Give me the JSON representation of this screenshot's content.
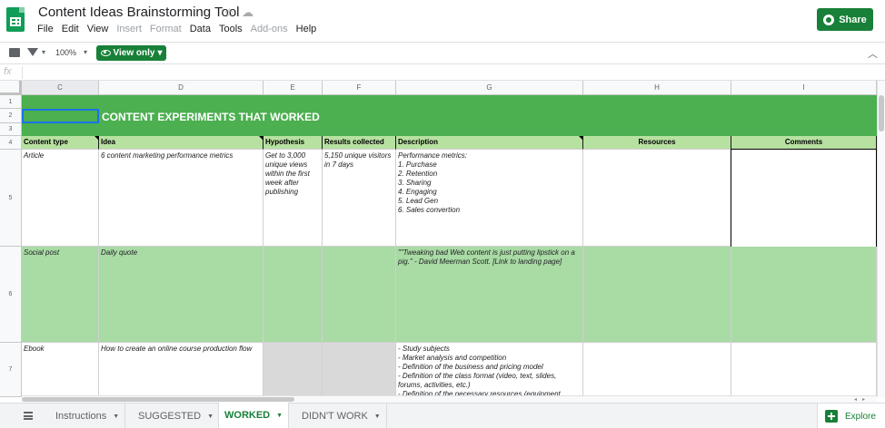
{
  "app": {
    "title": "Content Ideas Brainstorming Tool",
    "share_label": "Share",
    "menu": [
      "File",
      "Edit",
      "View",
      "Insert",
      "Format",
      "Data",
      "Tools",
      "Add-ons",
      "Help"
    ],
    "menu_disabled": [
      "Insert",
      "Format",
      "Add-ons"
    ]
  },
  "toolbar": {
    "zoom": "100%",
    "view_only_label": "View only",
    "fx": "fx"
  },
  "columns": [
    "C",
    "D",
    "E",
    "F",
    "G",
    "H",
    "I"
  ],
  "rows": [
    "1",
    "2",
    "3",
    "4",
    "5",
    "6",
    "7"
  ],
  "sheet": {
    "title": "CONTENT EXPERIMENTS THAT WORKED",
    "headers": {
      "content_type": "Content type",
      "idea": "Idea",
      "hypothesis": "Hypothesis",
      "results": "Results collected",
      "description": "Description",
      "resources": "Resources",
      "comments": "Comments"
    },
    "row5": {
      "content_type": "Article",
      "idea": "6 content marketing performance metrics",
      "hypothesis": "Get to 3,000 unique views within the first week after publishing",
      "results": "5,150 unique visitors in 7 days",
      "description": [
        "Performance metrics:",
        "1. Purchase",
        "2. Retention",
        "3. Sharing",
        "4. Engaging",
        "5. Lead Gen",
        "6. Sales convertion"
      ]
    },
    "row6": {
      "content_type": "Social post",
      "idea": "Daily quote",
      "description": "\"\"Tweaking bad Web content is just putting lipstick on a pig.\" - David Meerman Scott. [Link to landing page]"
    },
    "row7": {
      "content_type": "Ebook",
      "idea": "How to create an online course production flow",
      "description": [
        "- Study subjects",
        "- Market analysis and competition",
        "- Definition of the business and pricing model",
        "- Definition of the class format (video, text, slides, forums, activities, etc.)",
        "- Definition of the necessary resources (equipment,"
      ]
    }
  },
  "tabs": [
    {
      "label": "Instructions",
      "active": false
    },
    {
      "label": "SUGGESTED",
      "active": false
    },
    {
      "label": "WORKED",
      "active": true
    },
    {
      "label": "DIDN'T WORK",
      "active": false
    }
  ],
  "explore_label": "Explore",
  "colors": {
    "brand_green": "#188038",
    "title_green": "#4caf50",
    "header_green": "#b7e1a1",
    "row_green": "#a9dba5"
  }
}
